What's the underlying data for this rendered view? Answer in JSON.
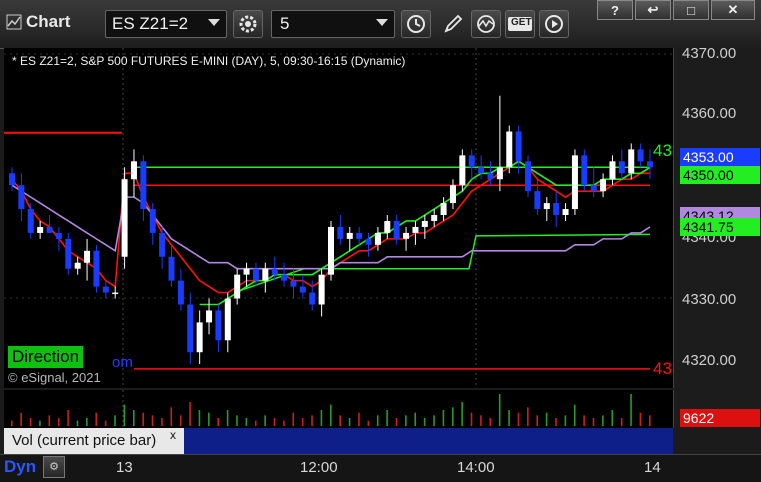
{
  "window": {
    "title": "Chart",
    "symbol": "ES Z21=2",
    "interval": "5",
    "controls": [
      "?",
      "↩",
      "□",
      "✕"
    ]
  },
  "toolbar": {
    "icons": [
      "settings-gear-icon",
      "clock-icon",
      "pen-draw-icon",
      "study-wave-icon",
      "get-data-icon",
      "play-icon"
    ],
    "get_label": "GET"
  },
  "chart_header": "* ES Z21=2, S&P 500 FUTURES E-MINI (DAY), 5, 09:30-16:15 (Dynamic)",
  "overlays": {
    "direction_label": "Direction",
    "partial_text": "om",
    "copyright": "© eSignal, 2021",
    "right_edge_green": "43",
    "right_edge_red": "43"
  },
  "price_axis": {
    "ticks": [
      "4370.00",
      "4360.00",
      "4340.00",
      "4330.00",
      "4320.00"
    ],
    "labels": [
      {
        "text": "4353.00",
        "bg": "#1a3cff",
        "color": "#ffffff"
      },
      {
        "text": "4350.00",
        "bg": "#22ee22",
        "color": "#000000"
      },
      {
        "text": "4343.12",
        "bg": "#b088e0",
        "color": "#000000"
      },
      {
        "text": "4341.75",
        "bg": "#22ee22",
        "color": "#000000"
      }
    ]
  },
  "volume": {
    "value": "9622",
    "label": "Vol (current price bar)",
    "close": "x"
  },
  "time_axis": {
    "ticks": [
      "13",
      "12:00",
      "14:00",
      "14"
    ],
    "dyn_label": "Dyn"
  },
  "colors": {
    "up_candle": "#ffffff",
    "down_candle": "#1a3cff",
    "red_line": "#ff1010",
    "green_line": "#22ee22",
    "purple_line": "#b088e0",
    "volume_up": "#2a9a2a",
    "volume_down": "#cc2020"
  },
  "chart_data": {
    "type": "candlestick",
    "ylim": [
      4316,
      4373
    ],
    "horizontal_levels": [
      {
        "value": 4353,
        "color": "#22ee22"
      },
      {
        "value": 4350,
        "color": "#ff1010"
      },
      {
        "value": 4319.2,
        "color": "#ff1010"
      },
      {
        "value": 4341.75,
        "color": "#22ee22"
      }
    ],
    "candles": [
      [
        4352,
        4353,
        4349,
        4350
      ],
      [
        4350,
        4352,
        4344,
        4346
      ],
      [
        4346,
        4347,
        4341,
        4342
      ],
      [
        4342,
        4344,
        4341,
        4343
      ],
      [
        4343,
        4345,
        4342,
        4342
      ],
      [
        4342,
        4343,
        4339,
        4341
      ],
      [
        4341,
        4342,
        4335,
        4336
      ],
      [
        4336,
        4338,
        4335,
        4337
      ],
      [
        4337,
        4341,
        4334,
        4339
      ],
      [
        4339,
        4340,
        4332,
        4333
      ],
      [
        4333,
        4334,
        4331,
        4332
      ],
      [
        4332,
        4333,
        4331,
        4332
      ],
      [
        4338,
        4353,
        4336,
        4351
      ],
      [
        4351,
        4356,
        4348,
        4354
      ],
      [
        4354,
        4355,
        4344,
        4346
      ],
      [
        4346,
        4347,
        4340,
        4342
      ],
      [
        4342,
        4343,
        4336,
        4338
      ],
      [
        4338,
        4340,
        4333,
        4334
      ],
      [
        4334,
        4336,
        4329,
        4330
      ],
      [
        4330,
        4332,
        4320,
        4322
      ],
      [
        4322,
        4329,
        4320,
        4327
      ],
      [
        4327,
        4331,
        4325,
        4329
      ],
      [
        4329,
        4330,
        4322,
        4324
      ],
      [
        4324,
        4332,
        4322,
        4331
      ],
      [
        4331,
        4336,
        4330,
        4335
      ],
      [
        4335,
        4337,
        4333,
        4336
      ],
      [
        4336,
        4337,
        4333,
        4334
      ],
      [
        4334,
        4337,
        4332,
        4336
      ],
      [
        4336,
        4338,
        4334,
        4335
      ],
      [
        4335,
        4337,
        4333,
        4334
      ],
      [
        4334,
        4336,
        4331,
        4333
      ],
      [
        4333,
        4335,
        4331,
        4332
      ],
      [
        4332,
        4334,
        4329,
        4330
      ],
      [
        4330,
        4336,
        4328,
        4335
      ],
      [
        4335,
        4344,
        4334,
        4343
      ],
      [
        4343,
        4345,
        4340,
        4341
      ],
      [
        4341,
        4343,
        4339,
        4342
      ],
      [
        4342,
        4343,
        4340,
        4341
      ],
      [
        4341,
        4342,
        4338,
        4340
      ],
      [
        4340,
        4343,
        4339,
        4342
      ],
      [
        4342,
        4345,
        4341,
        4344
      ],
      [
        4344,
        4345,
        4340,
        4341
      ],
      [
        4341,
        4343,
        4339,
        4342
      ],
      [
        4342,
        4344,
        4340,
        4343
      ],
      [
        4343,
        4345,
        4341,
        4344
      ],
      [
        4344,
        4346,
        4343,
        4345
      ],
      [
        4345,
        4348,
        4344,
        4347
      ],
      [
        4347,
        4351,
        4346,
        4350
      ],
      [
        4350,
        4356,
        4349,
        4355
      ],
      [
        4355,
        4356,
        4351,
        4353
      ],
      [
        4353,
        4355,
        4351,
        4352
      ],
      [
        4352,
        4354,
        4350,
        4351
      ],
      [
        4351,
        4365,
        4349,
        4353
      ],
      [
        4353,
        4360,
        4352,
        4359
      ],
      [
        4359,
        4360,
        4352,
        4354
      ],
      [
        4354,
        4355,
        4348,
        4349
      ],
      [
        4349,
        4351,
        4345,
        4346
      ],
      [
        4346,
        4348,
        4344,
        4347
      ],
      [
        4347,
        4349,
        4343,
        4345
      ],
      [
        4345,
        4347,
        4344,
        4346
      ],
      [
        4346,
        4356,
        4345,
        4355
      ],
      [
        4355,
        4356,
        4349,
        4350
      ],
      [
        4350,
        4353,
        4348,
        4349
      ],
      [
        4349,
        4352,
        4348,
        4351
      ],
      [
        4351,
        4355,
        4350,
        4354
      ],
      [
        4354,
        4356,
        4351,
        4352
      ],
      [
        4352,
        4357,
        4351,
        4356
      ],
      [
        4356,
        4357,
        4353,
        4354
      ],
      [
        4354,
        4356,
        4351,
        4353
      ]
    ],
    "volumes": [
      2,
      5,
      3,
      2,
      4,
      3,
      6,
      2,
      3,
      5,
      2,
      4,
      8,
      6,
      5,
      4,
      3,
      7,
      4,
      9,
      6,
      5,
      3,
      6,
      4,
      3,
      2,
      4,
      3,
      2,
      5,
      3,
      4,
      6,
      8,
      4,
      3,
      5,
      2,
      4,
      6,
      3,
      4,
      5,
      3,
      4,
      6,
      7,
      9,
      5,
      4,
      3,
      12,
      6,
      5,
      7,
      4,
      5,
      3,
      4,
      8,
      4,
      3,
      4,
      6,
      3,
      12,
      5,
      4
    ],
    "series": [
      {
        "color": "#ff1010",
        "values": [
          4351,
          4349,
          4346,
          4344,
          4343,
          4341,
          4339,
          4338,
          4337,
          4336,
          4334,
          4333,
          4352,
          4352,
          4348,
          4345,
          4342,
          4340,
          4338,
          4336,
          4334,
          4333,
          4332,
          4332,
          4333,
          4334,
          4334,
          4334,
          4335,
          4335,
          4334,
          4334,
          4333,
          4334,
          4336,
          4337,
          4338,
          4339,
          4339,
          4340,
          4341,
          4341,
          4341,
          4342,
          4342,
          4343,
          4344,
          4345,
          4347,
          4349,
          4350,
          4351,
          4352,
          4353,
          4354,
          4353,
          4351,
          4350,
          4349,
          4348,
          4349,
          4349,
          4349,
          4349,
          4350,
          4351,
          4351,
          4352,
          4352
        ]
      },
      {
        "color": "#b088e0",
        "values": [
          4350,
          4349,
          4348,
          4347,
          4346,
          4345,
          4344,
          4343,
          4342,
          4341,
          4340,
          4339,
          4348,
          4348,
          4347,
          4345,
          4343,
          4341,
          4340,
          4339,
          4338,
          4337,
          4337,
          4337,
          4336,
          4336,
          4336,
          4336,
          4336,
          4336,
          4336,
          4336,
          4336,
          4336,
          4336,
          4337,
          4337,
          4337,
          4337,
          4337,
          4338,
          4338,
          4338,
          4338,
          4338,
          4338,
          4338,
          4338,
          4338,
          4339,
          4339,
          4339,
          4339,
          4339,
          4339,
          4339,
          4339,
          4339,
          4339,
          4339,
          4340,
          4340,
          4340,
          4341,
          4341,
          4341,
          4342,
          4342,
          4343
        ]
      },
      {
        "color": "#22ee22",
        "values": [
          null,
          null,
          null,
          null,
          null,
          null,
          null,
          null,
          null,
          null,
          null,
          null,
          null,
          null,
          null,
          null,
          null,
          null,
          null,
          null,
          4330,
          4330,
          4330,
          4331,
          4332,
          4333,
          4334,
          4334,
          4335,
          4335,
          4335,
          4335,
          4335,
          4336,
          4337,
          4338,
          4339,
          4340,
          4341,
          4342,
          4342,
          4343,
          4344,
          4344,
          4345,
          4346,
          4347,
          4348,
          4349,
          4351,
          4352,
          4352,
          4353,
          4353,
          4354,
          4353,
          4352,
          4351,
          4350,
          4350,
          4350,
          4350,
          4350,
          4351,
          4351,
          4351,
          4352,
          4352,
          4353
        ]
      }
    ]
  }
}
